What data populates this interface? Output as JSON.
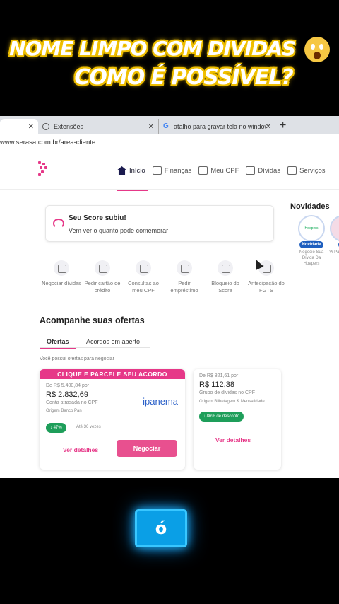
{
  "caption": {
    "line1": "NOME LIMPO COM DIVIDAS",
    "line2": "COMO É POSSÍVEL?",
    "emoji": "screaming-face"
  },
  "browser": {
    "tabs": [
      {
        "label": "",
        "close": "✕"
      },
      {
        "label": "Extensões",
        "close": "✕"
      },
      {
        "label": "atalho para gravar tela no window",
        "close": "✕"
      }
    ],
    "new_tab": "+",
    "url": "www.serasa.com.br/area-cliente"
  },
  "nav": {
    "items": [
      "Início",
      "Finanças",
      "Meu CPF",
      "Dívidas",
      "Serviços"
    ],
    "active": "Início"
  },
  "score_card": {
    "title": "Seu Score subiu!",
    "subtitle": "Vem ver o quanto pode comemorar"
  },
  "novidades": {
    "title": "Novidades",
    "items": [
      {
        "badge": "Novidade",
        "label": "Negocie Sua Dívida Da Hoepers",
        "logo": "Hoepers"
      },
      {
        "badge": "No",
        "label": "Vi Para"
      }
    ]
  },
  "shortcuts": [
    {
      "label": "Negociar dívidas"
    },
    {
      "label": "Pedir cartão de crédito"
    },
    {
      "label": "Consultas ao meu CPF"
    },
    {
      "label": "Pedir empréstimo"
    },
    {
      "label": "Bloqueio do Score"
    },
    {
      "label": "Antecipação do FGTS"
    }
  ],
  "offers": {
    "title": "Acompanhe suas ofertas",
    "tabs": [
      "Ofertas",
      "Acordos em aberto"
    ],
    "info": "Você possui ofertas para negociar",
    "card1": {
      "banner": "CLIQUE E PARCELE SEU ACORDO",
      "from": "De R$ 5.400,84 por",
      "price": "R$ 2.832,69",
      "desc": "Conta atrasada no CPF",
      "origin": "Origem Banco Pan",
      "brand": "ipanema",
      "discount": "47%",
      "installments": "Até 36 vezes",
      "details": "Ver detalhes",
      "cta": "Negociar"
    },
    "card2": {
      "from": "De R$ 821,61 por",
      "price": "R$ 112,38",
      "desc": "Grupo de dívidas no CPF",
      "origin": "Origem Bilhetagem & Mensalidade",
      "discount": "86% de desconto",
      "details": "Ver detalhes"
    }
  },
  "keycap": {
    "label": "ó"
  },
  "colors": {
    "accent": "#e63888",
    "caption_glow": "#f5c400",
    "keycap": "#0a9fe6"
  }
}
